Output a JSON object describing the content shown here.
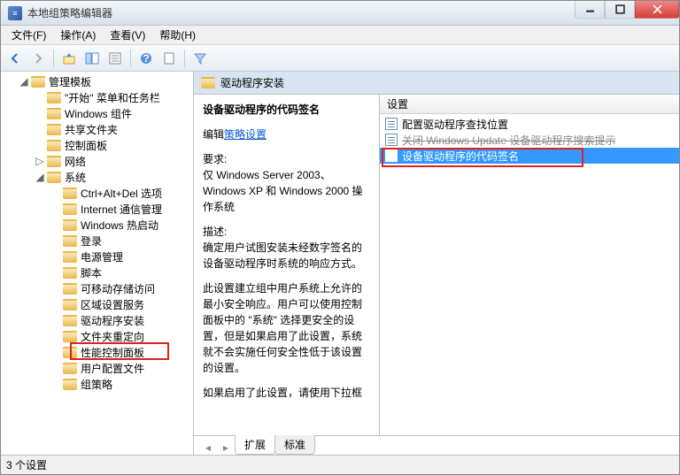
{
  "window": {
    "title": "本地组策略编辑器"
  },
  "menu": {
    "file": "文件(F)",
    "action": "操作(A)",
    "view": "查看(V)",
    "help": "帮助(H)"
  },
  "tree": {
    "root": "管理模板",
    "items": [
      "\"开始\" 菜单和任务栏",
      "Windows 组件",
      "共享文件夹",
      "控制面板",
      "网络",
      "系统"
    ],
    "system_children": [
      "Ctrl+Alt+Del 选项",
      "Internet 通信管理",
      "Windows 热启动",
      "登录",
      "电源管理",
      "脚本",
      "可移动存储访问",
      "区域设置服务",
      "驱动程序安装",
      "文件夹重定向",
      "性能控制面板",
      "用户配置文件",
      "组策略"
    ]
  },
  "content": {
    "header": "驱动程序安装",
    "desc_title": "设备驱动程序的代码签名",
    "edit_label": "编辑",
    "link": "策略设置",
    "req_label": "要求:",
    "req_text": "仅 Windows Server 2003、Windows XP 和 Windows 2000 操作系统",
    "desc_label": "描述:",
    "desc1": "确定用户试图安装未经数字签名的设备驱动程序时系统的响应方式。",
    "desc2": "此设置建立组中用户系统上允许的最小安全响应。用户可以使用控制面板中的 \"系统\" 选择更安全的设置，但是如果启用了此设置，系统就不会实施任何安全性低于该设置的设置。",
    "desc3": "如果启用了此设置，请使用下拉框"
  },
  "list": {
    "header": "设置",
    "items": [
      "配置驱动程序查找位置",
      "关闭 Windows Update 设备驱动程序搜索提示",
      "设备驱动程序的代码签名"
    ]
  },
  "tabs": {
    "extended": "扩展",
    "standard": "标准"
  },
  "status": "3 个设置"
}
